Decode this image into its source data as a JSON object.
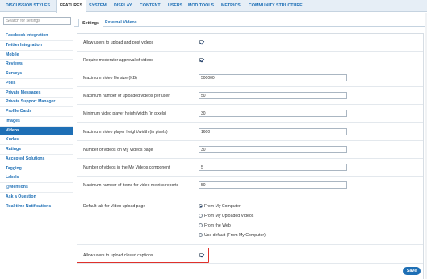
{
  "topnav": {
    "tabs": [
      {
        "label": "DISCUSSION STYLES"
      },
      {
        "label": "FEATURES"
      },
      {
        "label": "SYSTEM"
      },
      {
        "label": "DISPLAY"
      },
      {
        "label": "CONTENT"
      },
      {
        "label": "USERS"
      },
      {
        "label": "MOD TOOLS"
      },
      {
        "label": "METRICS"
      },
      {
        "label": "COMMUNITY STRUCTURE"
      }
    ],
    "active": "FEATURES"
  },
  "sidebar": {
    "search_placeholder": "Search for settings",
    "items": [
      {
        "label": "Facebook Integration"
      },
      {
        "label": "Twitter Integration"
      },
      {
        "label": "Mobile"
      },
      {
        "label": "Reviews"
      },
      {
        "label": "Surveys"
      },
      {
        "label": "Polls"
      },
      {
        "label": "Private Messages"
      },
      {
        "label": "Private Support Manager"
      },
      {
        "label": "Profile Cards"
      },
      {
        "label": "Images"
      },
      {
        "label": "Videos"
      },
      {
        "label": "Kudos"
      },
      {
        "label": "Ratings"
      },
      {
        "label": "Accepted Solutions"
      },
      {
        "label": "Tagging"
      },
      {
        "label": "Labels"
      },
      {
        "label": "@Mentions"
      },
      {
        "label": "Ask a Question"
      },
      {
        "label": "Real-time Notifications"
      }
    ],
    "active": "Videos"
  },
  "subtabs": [
    {
      "label": "Settings"
    },
    {
      "label": "External Videos"
    }
  ],
  "settings": {
    "allow_upload": {
      "label": "Allow users to upload and post videos",
      "checked": true
    },
    "require_approval": {
      "label": "Require moderator approval of videos",
      "checked": true
    },
    "max_file_size": {
      "label": "Maximum video file size (KB)",
      "value": "500000"
    },
    "max_uploaded": {
      "label": "Maximum number of uploaded videos per user",
      "value": "50"
    },
    "min_dims": {
      "label": "Minimum video player height/width (in pixels)",
      "value": "30"
    },
    "max_dims": {
      "label": "Maximum video player height/width (in pixels)",
      "value": "1600"
    },
    "videos_on_page": {
      "label": "Number of videos on My Videos page",
      "value": "30"
    },
    "videos_in_component": {
      "label": "Number of videos in the My Videos component",
      "value": "5"
    },
    "metrics_items": {
      "label": "Maximum number of items for video metrics reports",
      "value": "50"
    },
    "default_tab": {
      "label": "Default tab for Video upload page",
      "options": [
        {
          "label": "From My Computer",
          "selected": true
        },
        {
          "label": "From My Uploaded Videos",
          "selected": false
        },
        {
          "label": "From the Web",
          "selected": false
        },
        {
          "label": "Use default (From My Computer)",
          "selected": false
        }
      ]
    },
    "closed_captions": {
      "label": "Allow users to upload closed captions",
      "checked": true
    }
  },
  "save_label": "Save",
  "colors": {
    "accent": "#1e6fb5",
    "highlight": "#e0312b"
  }
}
